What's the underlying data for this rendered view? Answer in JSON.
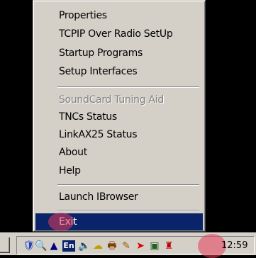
{
  "menu": {
    "items": [
      {
        "label": "Properties",
        "enabled": true
      },
      {
        "label": "TCPIP Over Radio SetUp",
        "enabled": true
      },
      {
        "label": "Startup Programs",
        "enabled": true
      },
      {
        "label": "Setup Interfaces",
        "enabled": true
      },
      {
        "label": "SoundCard Tuning Aid",
        "enabled": false
      },
      {
        "label": "TNCs Status",
        "enabled": true
      },
      {
        "label": "LinkAX25 Status",
        "enabled": true
      },
      {
        "label": "About",
        "enabled": true
      },
      {
        "label": "Help",
        "enabled": true
      },
      {
        "label": "Launch IBrowser",
        "enabled": true
      },
      {
        "label": "Exit",
        "enabled": true,
        "selected": true
      }
    ]
  },
  "taskbar": {
    "language_indicator": "En",
    "clock": "12:59",
    "tray_icons": [
      "shield-icon",
      "magnifier-icon",
      "language-en-icon",
      "speaker-icon",
      "network-icon",
      "printer-icon",
      "pencil-icon",
      "arrow-icon",
      "monitor-icon",
      "radio-app-icon"
    ]
  },
  "colors": {
    "menu_bg": "#d4d0c8",
    "selection": "#0a246a",
    "highlight_mark": "#e63c5a"
  }
}
